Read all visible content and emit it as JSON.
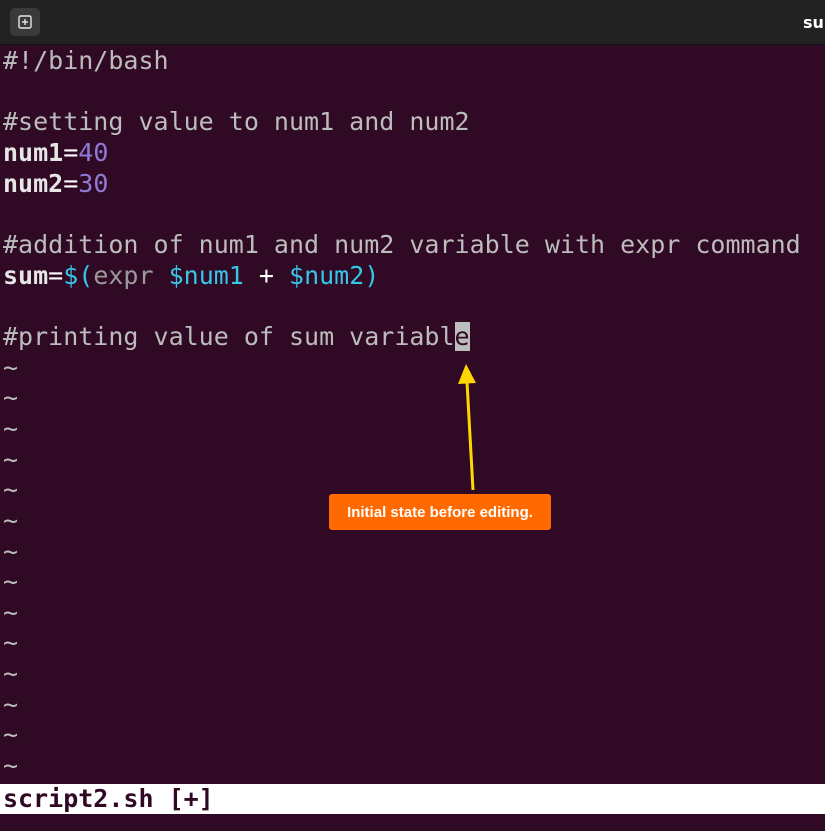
{
  "window": {
    "title": "su",
    "new_tab_icon": "new-tab-icon"
  },
  "editor": {
    "lines": [
      {
        "parts": [
          {
            "t": "#!/bin/bash",
            "c": "comment"
          }
        ]
      },
      {
        "parts": []
      },
      {
        "parts": [
          {
            "t": "#setting value to num1 and num2",
            "c": "comment"
          }
        ]
      },
      {
        "parts": [
          {
            "t": "num1",
            "c": "var"
          },
          {
            "t": "=",
            "c": "op"
          },
          {
            "t": "40",
            "c": "num"
          }
        ]
      },
      {
        "parts": [
          {
            "t": "num2",
            "c": "var"
          },
          {
            "t": "=",
            "c": "op"
          },
          {
            "t": "30",
            "c": "num"
          }
        ]
      },
      {
        "parts": []
      },
      {
        "parts": [
          {
            "t": "#addition of num1 and num2 variable with expr command",
            "c": "comment"
          }
        ]
      },
      {
        "parts": [
          {
            "t": "sum",
            "c": "var"
          },
          {
            "t": "=",
            "c": "op"
          },
          {
            "t": "$(",
            "c": "cyan"
          },
          {
            "t": "expr ",
            "c": "dim"
          },
          {
            "t": "$num1",
            "c": "cyan"
          },
          {
            "t": " + ",
            "c": "op"
          },
          {
            "t": "$num2",
            "c": "cyan"
          },
          {
            "t": ")",
            "c": "cyan"
          }
        ]
      },
      {
        "parts": []
      },
      {
        "parts": [
          {
            "t": "#printing value of sum variabl",
            "c": "comment"
          },
          {
            "t": "e",
            "c": "cursor"
          }
        ]
      }
    ],
    "tilde": "~",
    "tilde_count": 14
  },
  "status": {
    "text": "script2.sh [+]"
  },
  "annotation": {
    "label": "Initial state before editing.",
    "color": "#ff6a00",
    "arrow_color": "#ffd700"
  }
}
